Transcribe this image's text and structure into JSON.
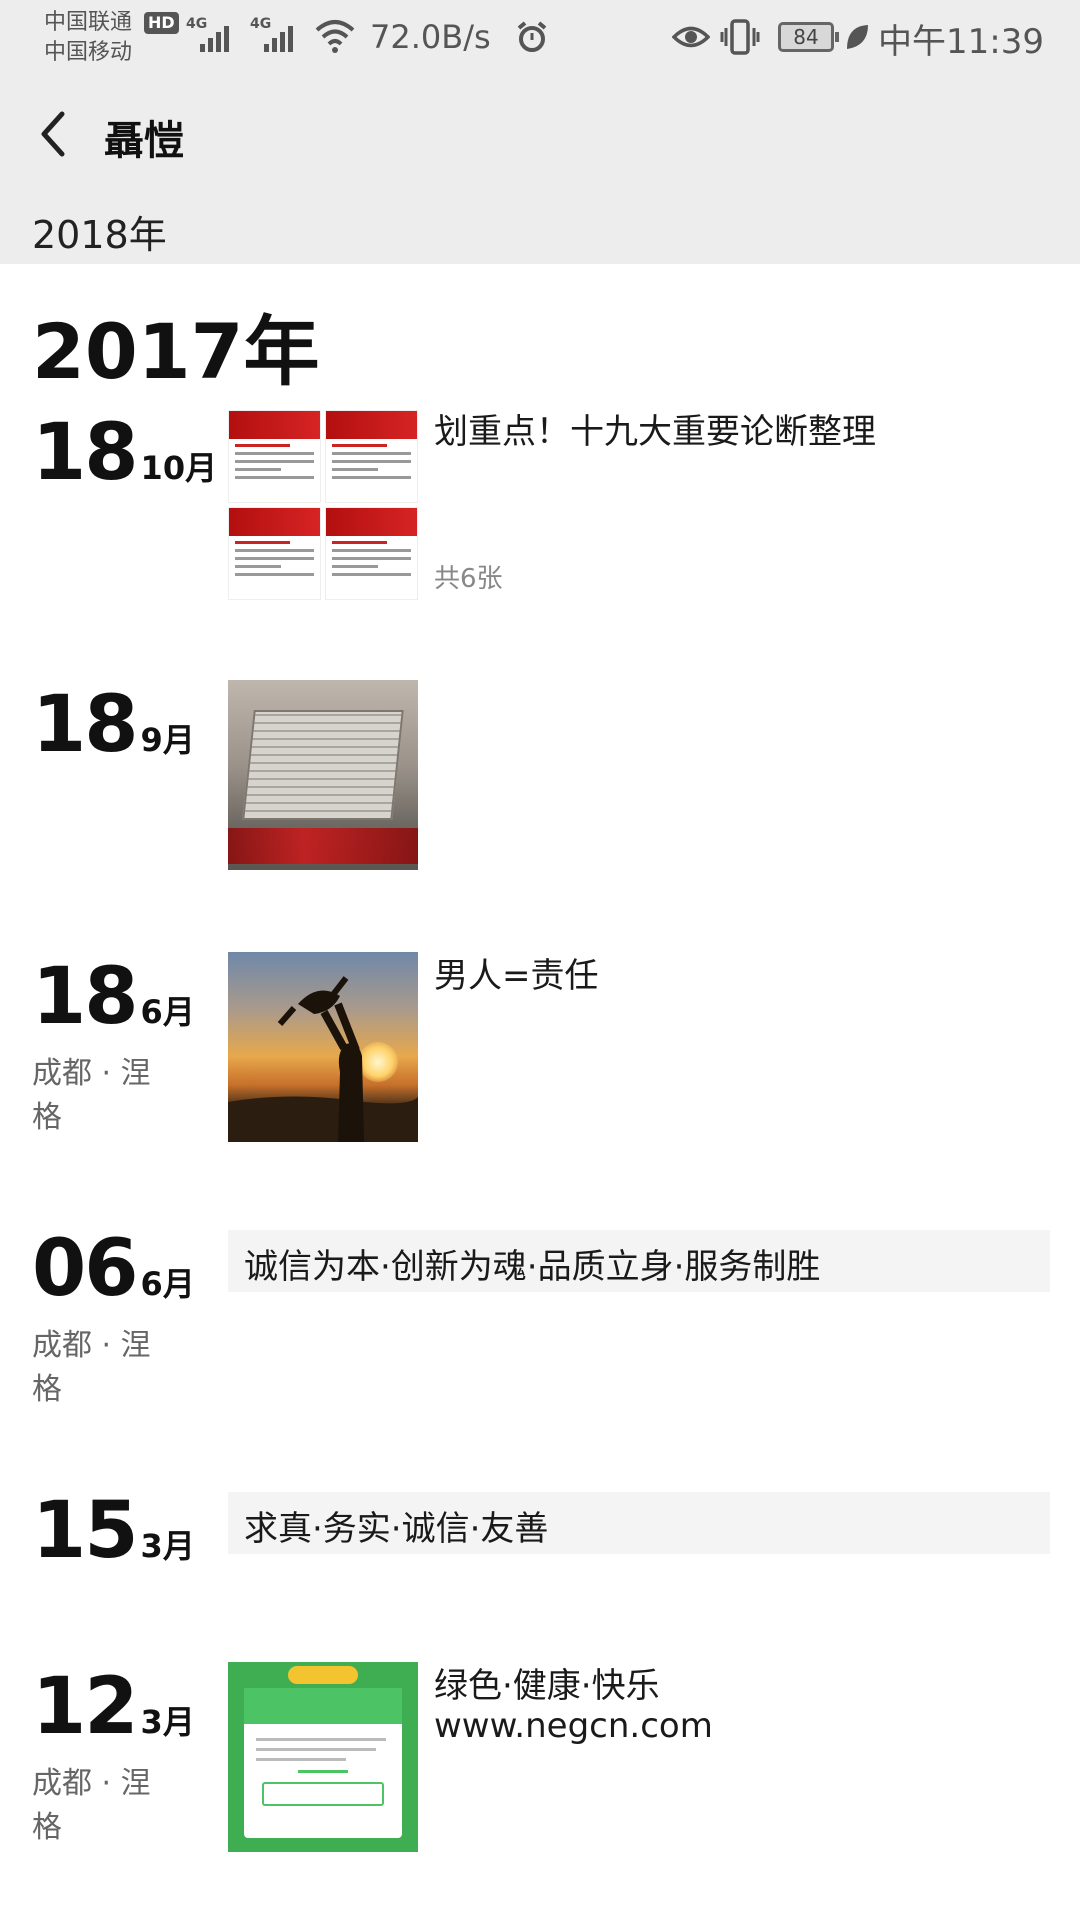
{
  "status_bar": {
    "carrier_1": "中国联通",
    "carrier_2": "中国移动",
    "hd": "HD",
    "network_1": "4G",
    "network_2": "4G",
    "speed": "72.0B/s",
    "battery": "84",
    "time": "中午11:39",
    "icons": [
      "signal-icon",
      "wifi-icon",
      "alarm-icon",
      "eye-icon",
      "vibrate-icon",
      "battery-icon",
      "leaf-icon"
    ]
  },
  "header": {
    "back_icon": "chevron-left-icon",
    "title": "聶愷"
  },
  "year_bar": {
    "label": "2018年"
  },
  "timeline": {
    "year": "2017年",
    "posts": [
      {
        "day": "18",
        "month": "10月",
        "location": "",
        "text": "划重点！十九大重要论断整理",
        "photo_count": "共6张",
        "thumb": "document-collage"
      },
      {
        "day": "18",
        "month": "9月",
        "location": "",
        "text": "",
        "thumb": "monument-photo"
      },
      {
        "day": "18",
        "month": "6月",
        "location": "成都 · 涅格",
        "text": "男人=责任",
        "thumb": "sunset-photo"
      },
      {
        "day": "06",
        "month": "6月",
        "location": "成都 · 涅格",
        "text": "诚信为本·创新为魂·品质立身·服务制胜"
      },
      {
        "day": "15",
        "month": "3月",
        "location": "",
        "text": "求真·务实·诚信·友善"
      },
      {
        "day": "12",
        "month": "3月",
        "location": "成都 · 涅格",
        "text_line1": "绿色·健康·快乐",
        "text_line2": "www.negcn.com",
        "thumb": "certificate-image"
      }
    ]
  },
  "colors": {
    "header_bg": "#ededed",
    "page_bg": "#ffffff",
    "text_primary": "#1a1a1a",
    "text_secondary": "#666666",
    "text_only_bg": "#f4f4f4"
  }
}
